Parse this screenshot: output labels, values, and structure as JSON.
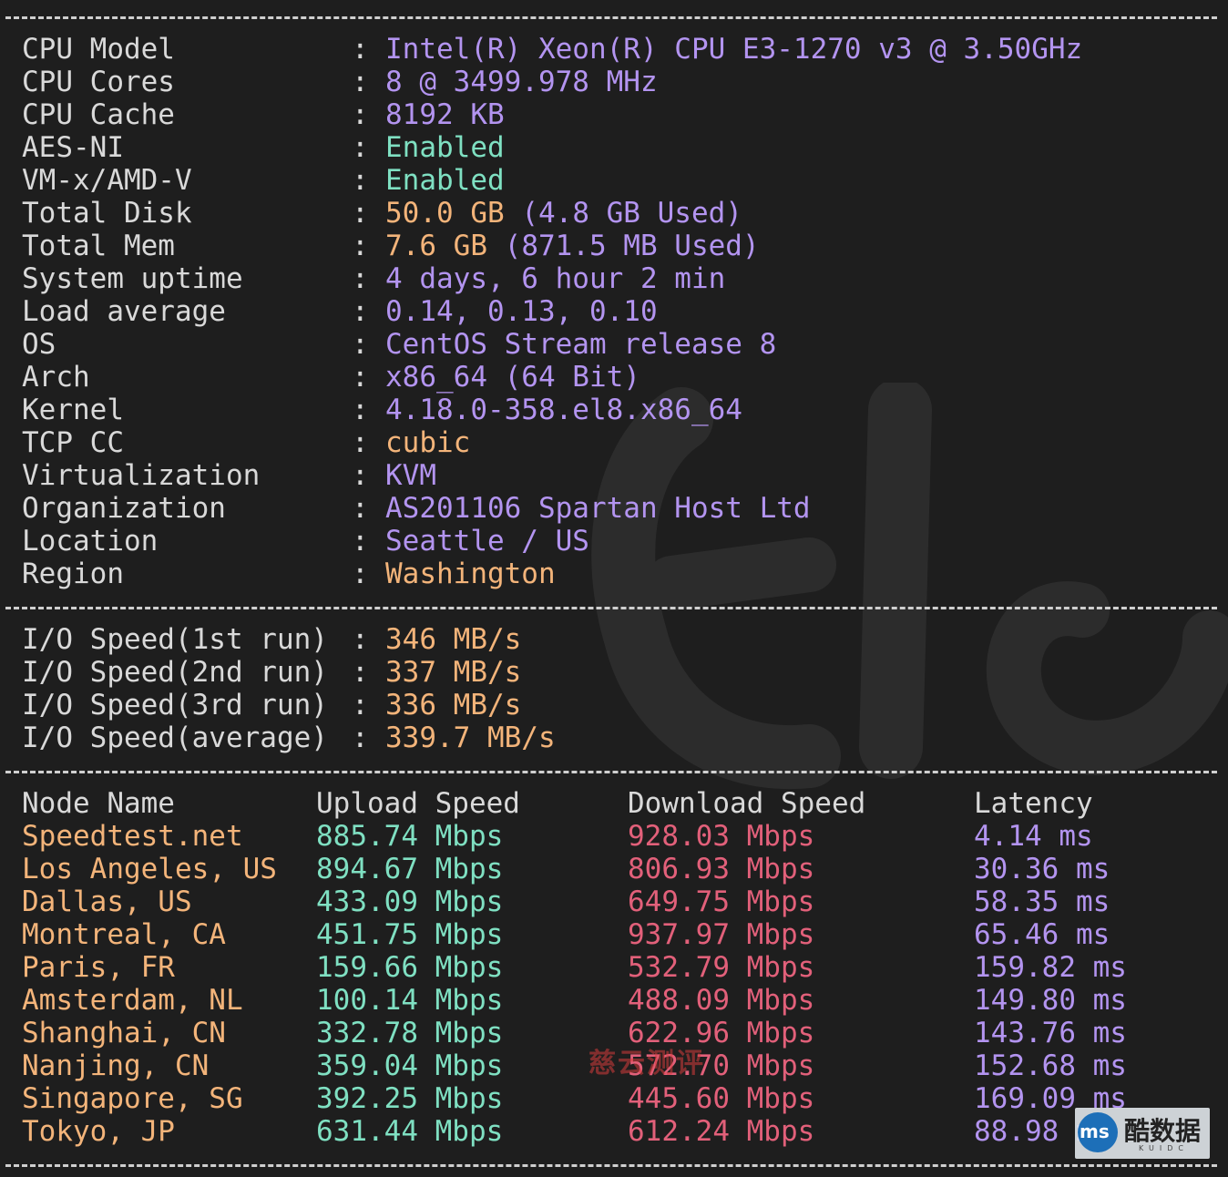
{
  "system_info": [
    {
      "label": "CPU Model",
      "value": "Intel(R) Xeon(R) CPU E3-1270 v3 @ 3.50GHz",
      "color": "purple"
    },
    {
      "label": "CPU Cores",
      "value": "8 @ 3499.978 MHz",
      "color": "purple"
    },
    {
      "label": "CPU Cache",
      "value": "8192 KB",
      "color": "purple"
    },
    {
      "label": "AES-NI",
      "value": "Enabled",
      "color": "green"
    },
    {
      "label": "VM-x/AMD-V",
      "value": "Enabled",
      "color": "green"
    },
    {
      "label": "Total Disk",
      "value": "50.0 GB",
      "value_extra": "(4.8 GB Used)",
      "color": "orange",
      "extra_color": "purple"
    },
    {
      "label": "Total Mem",
      "value": "7.6 GB",
      "value_extra": "(871.5 MB Used)",
      "color": "orange",
      "extra_color": "purple"
    },
    {
      "label": "System uptime",
      "value": "4 days, 6 hour 2 min",
      "color": "purple"
    },
    {
      "label": "Load average",
      "value": "0.14, 0.13, 0.10",
      "color": "purple"
    },
    {
      "label": "OS",
      "value": "CentOS Stream release 8",
      "color": "purple"
    },
    {
      "label": "Arch",
      "value": "x86_64 (64 Bit)",
      "color": "purple"
    },
    {
      "label": "Kernel",
      "value": "4.18.0-358.el8.x86_64",
      "color": "purple"
    },
    {
      "label": "TCP CC",
      "value": "cubic",
      "color": "orange"
    },
    {
      "label": "Virtualization",
      "value": "KVM",
      "color": "purple"
    },
    {
      "label": "Organization",
      "value": "AS201106 Spartan Host Ltd",
      "color": "purple"
    },
    {
      "label": "Location",
      "value": "Seattle / US",
      "color": "purple"
    },
    {
      "label": "Region",
      "value": "Washington",
      "color": "orange"
    }
  ],
  "io_speed": [
    {
      "label": "I/O Speed(1st run)",
      "value": "346 MB/s"
    },
    {
      "label": "I/O Speed(2nd run)",
      "value": "337 MB/s"
    },
    {
      "label": "I/O Speed(3rd run)",
      "value": "336 MB/s"
    },
    {
      "label": "I/O Speed(average)",
      "value": "339.7 MB/s"
    }
  ],
  "speed_table": {
    "headers": {
      "node": "Node Name",
      "upload": "Upload Speed",
      "download": "Download Speed",
      "latency": "Latency"
    },
    "rows": [
      {
        "node": "Speedtest.net",
        "upload": "885.74 Mbps",
        "download": "928.03 Mbps",
        "latency": "4.14 ms"
      },
      {
        "node": "Los Angeles, US",
        "upload": "894.67 Mbps",
        "download": "806.93 Mbps",
        "latency": "30.36 ms"
      },
      {
        "node": "Dallas, US",
        "upload": "433.09 Mbps",
        "download": "649.75 Mbps",
        "latency": "58.35 ms"
      },
      {
        "node": "Montreal, CA",
        "upload": "451.75 Mbps",
        "download": "937.97 Mbps",
        "latency": "65.46 ms"
      },
      {
        "node": "Paris, FR",
        "upload": "159.66 Mbps",
        "download": "532.79 Mbps",
        "latency": "159.82 ms"
      },
      {
        "node": "Amsterdam, NL",
        "upload": "100.14 Mbps",
        "download": "488.09 Mbps",
        "latency": "149.80 ms"
      },
      {
        "node": "Shanghai, CN",
        "upload": "332.78 Mbps",
        "download": "622.96 Mbps",
        "latency": "143.76 ms"
      },
      {
        "node": "Nanjing, CN",
        "upload": "359.04 Mbps",
        "download": "572.70 Mbps",
        "latency": "152.68 ms"
      },
      {
        "node": "Singapore, SG",
        "upload": "392.25 Mbps",
        "download": "445.60 Mbps",
        "latency": "169.09 ms"
      },
      {
        "node": "Tokyo, JP",
        "upload": "631.44 Mbps",
        "download": "612.24 Mbps",
        "latency": "88.98 ms"
      }
    ]
  },
  "colon": ":",
  "watermark": {
    "text": "慈云测评"
  },
  "badge": {
    "ms": "ms",
    "title": "酷数据",
    "subtitle": "KUIDC"
  },
  "colors": {
    "background": "#1e1e1e",
    "label": "#d9d9d9",
    "purple": "#b394f0",
    "green": "#7fe0c2",
    "orange": "#f3b47a",
    "red": "#e2607a"
  }
}
